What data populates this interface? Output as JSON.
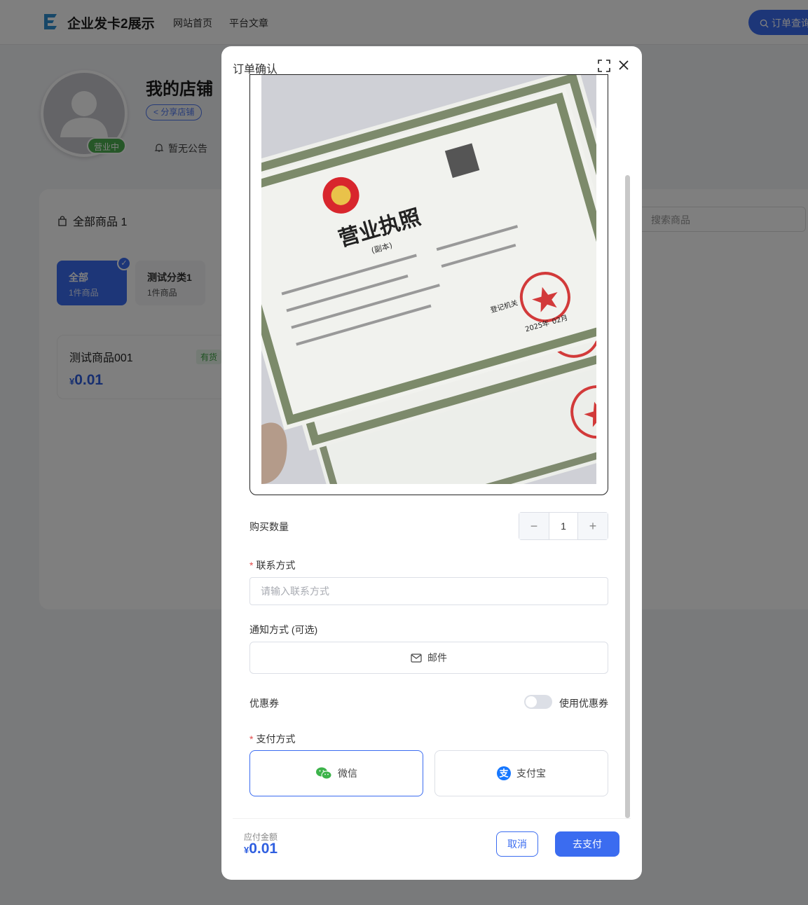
{
  "header": {
    "site_title": "企业发卡2展示",
    "nav": [
      "网站首页",
      "平台文章"
    ],
    "order_query": "订单查询"
  },
  "shop": {
    "name": "我的店铺",
    "status": "营业中",
    "share_label": "分享店铺",
    "notice": "暂无公告"
  },
  "goods": {
    "all_label": "全部商品 1",
    "search_placeholder": "搜索商品",
    "categories": [
      {
        "name": "全部",
        "count": "1件商品",
        "selected": true
      },
      {
        "name": "测试分类1",
        "count": "1件商品",
        "selected": false
      }
    ],
    "products": [
      {
        "name": "测试商品001",
        "stock": "有货",
        "currency": "¥",
        "price": "0.01"
      }
    ]
  },
  "modal": {
    "title": "订单确认",
    "quantity_label": "购买数量",
    "quantity": "1",
    "contact_label": "联系方式",
    "contact_placeholder": "请输入联系方式",
    "notify_label": "通知方式 (可选)",
    "notify_option": "邮件",
    "coupon_label": "优惠券",
    "coupon_toggle_label": "使用优惠券",
    "coupon_enabled": false,
    "payment_label": "支付方式",
    "payment_methods": [
      {
        "name": "微信",
        "icon": "wechat-icon",
        "selected": true
      },
      {
        "name": "支付宝",
        "icon": "alipay-icon",
        "selected": false
      }
    ],
    "amount_label": "应付金额",
    "amount_currency": "¥",
    "amount_value": "0.01",
    "cancel_label": "取消",
    "pay_label": "去支付",
    "license_text": {
      "title": "营业执照",
      "subtitle": "(副本)",
      "stamp_office": "登记机关",
      "year": "2025年",
      "month": "02月"
    }
  },
  "colors": {
    "accent": "#3b6cf0",
    "price": "#2f5fe0",
    "status_green": "#4caf50",
    "required": "#e24c4c"
  }
}
